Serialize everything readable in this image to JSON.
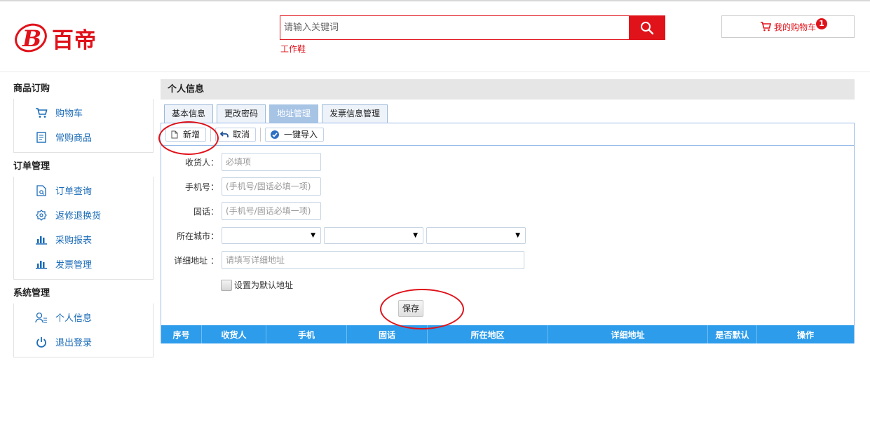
{
  "brand": {
    "name": "百帝",
    "logo_letter": "B"
  },
  "search": {
    "placeholder": "请输入关键词",
    "hot_word": "工作鞋"
  },
  "cart": {
    "label": "我的购物车",
    "count": "1"
  },
  "sidebar": {
    "groups": [
      {
        "title": "商品订购",
        "items": [
          {
            "label": "购物车",
            "icon": "cart-icon"
          },
          {
            "label": "常购商品",
            "icon": "document-icon"
          }
        ]
      },
      {
        "title": "订单管理",
        "items": [
          {
            "label": "订单查询",
            "icon": "file-search-icon"
          },
          {
            "label": "返修退换货",
            "icon": "badge-icon"
          },
          {
            "label": "采购报表",
            "icon": "bar-chart-icon"
          },
          {
            "label": "发票管理",
            "icon": "bar-chart-icon"
          }
        ]
      },
      {
        "title": "系统管理",
        "items": [
          {
            "label": "个人信息",
            "icon": "user-icon"
          },
          {
            "label": "退出登录",
            "icon": "power-icon"
          }
        ]
      }
    ]
  },
  "panel": {
    "title": "个人信息"
  },
  "tabs": [
    {
      "label": "基本信息"
    },
    {
      "label": "更改密码"
    },
    {
      "label": "地址管理",
      "active": true
    },
    {
      "label": "发票信息管理"
    }
  ],
  "toolbar": {
    "add": "新增",
    "cancel": "取消",
    "import": "一键导入"
  },
  "form": {
    "receiver_label": "收货人：",
    "receiver_placeholder": "必填项",
    "mobile_label": "手机号：",
    "mobile_placeholder": "(手机号/固话必填一项)",
    "phone_label": "固话：",
    "phone_placeholder": "(手机号/固话必填一项)",
    "city_label": "所在城市：",
    "detail_label": "详细地址 ：",
    "detail_placeholder": "请填写详细地址",
    "default_label": "设置为默认地址",
    "save": "保存"
  },
  "grid": {
    "columns": [
      "序号",
      "收货人",
      "手机",
      "固话",
      "所在地区",
      "详细地址",
      "是否默认",
      "操作"
    ]
  },
  "colors": {
    "brand_red": "#e0121a",
    "link_blue": "#1a6bb8",
    "grid_head": "#2d9ceb",
    "tab_active": "#a7c4e5"
  }
}
